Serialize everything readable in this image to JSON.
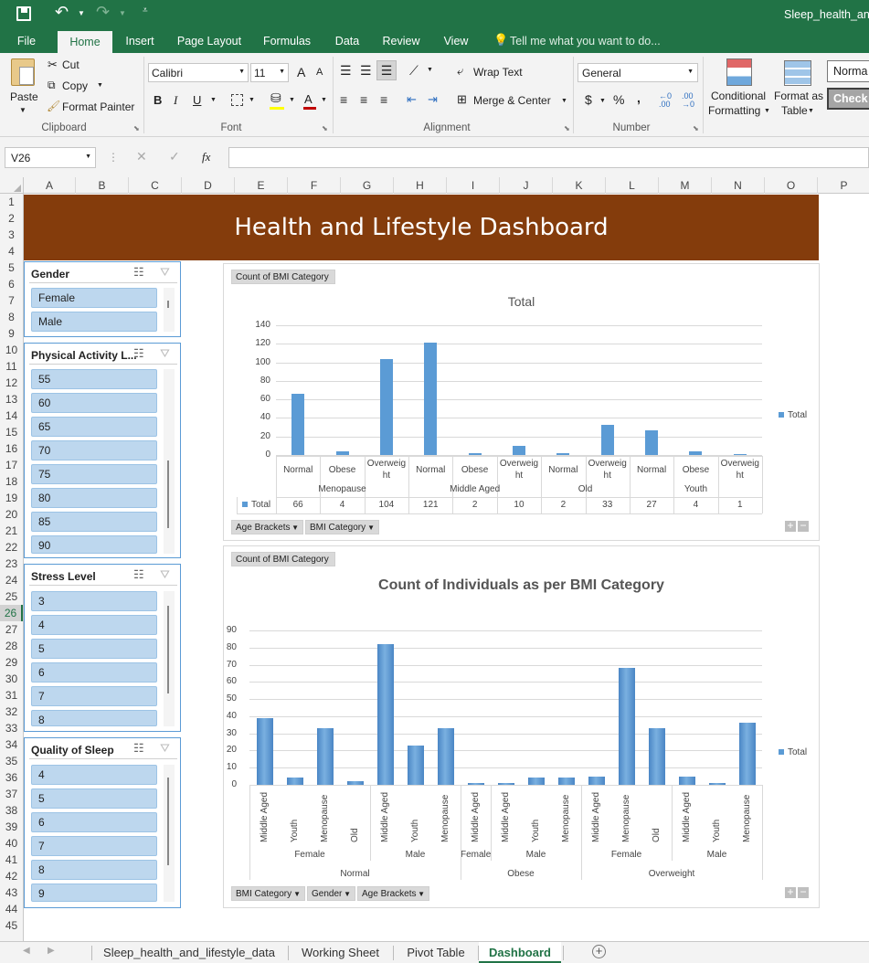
{
  "window": {
    "title": "Sleep_health_and_"
  },
  "ribbon_tabs": [
    "File",
    "Home",
    "Insert",
    "Page Layout",
    "Formulas",
    "Data",
    "Review",
    "View"
  ],
  "tell_me": "Tell me what you want to do...",
  "clipboard": {
    "paste": "Paste",
    "cut": "Cut",
    "copy": "Copy",
    "format_painter": "Format Painter",
    "group": "Clipboard"
  },
  "font": {
    "name": "Calibri",
    "size": "11",
    "group": "Font",
    "bold": "B",
    "italic": "I",
    "underline": "U",
    "grow": "A",
    "shrink": "A",
    "color": "A"
  },
  "alignment": {
    "wrap": "Wrap Text",
    "merge": "Merge & Center",
    "group": "Alignment"
  },
  "number": {
    "format": "General",
    "currency": "$",
    "percent": "%",
    "comma": ",",
    "group": "Number"
  },
  "styles": {
    "conditional": [
      "Conditional",
      "Formatting"
    ],
    "format_table": [
      "Format as",
      "Table"
    ],
    "normal": "Norma",
    "check": "Check"
  },
  "formula_bar": {
    "name_box": "V26",
    "fx": "fx",
    "value": ""
  },
  "columns": [
    "A",
    "B",
    "C",
    "D",
    "E",
    "F",
    "G",
    "H",
    "I",
    "J",
    "K",
    "L",
    "M",
    "N",
    "O",
    "P"
  ],
  "rows": [
    "1",
    "2",
    "3",
    "4",
    "5",
    "6",
    "7",
    "8",
    "9",
    "10",
    "11",
    "12",
    "13",
    "14",
    "15",
    "16",
    "17",
    "18",
    "19",
    "20",
    "21",
    "22",
    "23",
    "24",
    "25",
    "26",
    "27",
    "28",
    "29",
    "30",
    "31",
    "32",
    "33",
    "34",
    "35",
    "36",
    "37",
    "38",
    "39",
    "40",
    "41",
    "42",
    "43",
    "44",
    "45"
  ],
  "dashboard_title": "Health and Lifestyle Dashboard",
  "slicers": [
    {
      "title": "Gender",
      "items": [
        "Female",
        "Male"
      ]
    },
    {
      "title": "Physical Activity L...",
      "items": [
        "55",
        "60",
        "65",
        "70",
        "75",
        "80",
        "85",
        "90"
      ]
    },
    {
      "title": "Stress Level",
      "items": [
        "3",
        "4",
        "5",
        "6",
        "7",
        "8"
      ]
    },
    {
      "title": "Quality of Sleep",
      "items": [
        "4",
        "5",
        "6",
        "7",
        "8",
        "9"
      ]
    }
  ],
  "chart1": {
    "field_button": "Count of BMI Category",
    "title": "Total",
    "legend": "Total",
    "row_fields": [
      "Age Brackets",
      "BMI Category"
    ],
    "chart_data": {
      "type": "bar",
      "title": "Total",
      "ylim": [
        0,
        140
      ],
      "yticks": [
        "0",
        "20",
        "40",
        "60",
        "80",
        "100",
        "120",
        "140"
      ],
      "groups": [
        {
          "name": "Menopause",
          "categories": [
            "Normal",
            "Obese",
            "Overweight"
          ],
          "values": [
            66,
            4,
            104
          ]
        },
        {
          "name": "Middle Aged",
          "categories": [
            "Normal",
            "Obese",
            "Overweight"
          ],
          "values": [
            121,
            2,
            10
          ]
        },
        {
          "name": "Old",
          "categories": [
            "Normal",
            "Overweight"
          ],
          "values": [
            2,
            33
          ]
        },
        {
          "name": "Youth",
          "categories": [
            "Normal",
            "Obese",
            "Overweight"
          ],
          "values": [
            27,
            4,
            1
          ]
        }
      ],
      "series": [
        {
          "name": "Total",
          "values": [
            66,
            4,
            104,
            121,
            2,
            10,
            2,
            33,
            27,
            4,
            1
          ]
        }
      ],
      "data_table_label": "Total"
    }
  },
  "chart2": {
    "field_button": "Count of BMI Category",
    "title": "Count of Individuals as per BMI Category",
    "legend": "Total",
    "row_fields": [
      "BMI Category",
      "Gender",
      "Age Brackets"
    ],
    "chart_data": {
      "type": "bar",
      "title": "Count of Individuals as per BMI Category",
      "ylim": [
        0,
        90
      ],
      "yticks": [
        "0",
        "10",
        "20",
        "30",
        "40",
        "50",
        "60",
        "70",
        "80",
        "90"
      ],
      "categories": [
        "Middle Aged",
        "Youth",
        "Menopause",
        "Old",
        "Middle Aged",
        "Youth",
        "Menopause",
        "Middle Aged",
        "Middle Aged",
        "Youth",
        "Menopause",
        "Middle Aged",
        "Menopause",
        "Old",
        "Middle Aged",
        "Youth",
        "Menopause"
      ],
      "values": [
        39,
        4,
        33,
        2,
        82,
        23,
        33,
        1,
        1,
        4,
        4,
        5,
        68,
        33,
        5,
        1,
        36
      ],
      "gender_groups": [
        {
          "name": "Female",
          "count": 4
        },
        {
          "name": "Male",
          "count": 3
        },
        {
          "name": "Female",
          "count": 1
        },
        {
          "name": "Male",
          "count": 3
        },
        {
          "name": "Female",
          "count": 3
        },
        {
          "name": "Male",
          "count": 3
        }
      ],
      "bmi_groups": [
        {
          "name": "Normal",
          "count": 7
        },
        {
          "name": "Obese",
          "count": 4
        },
        {
          "name": "Overweight",
          "count": 6
        }
      ],
      "series": [
        {
          "name": "Total",
          "values": [
            39,
            4,
            33,
            2,
            82,
            23,
            33,
            1,
            1,
            4,
            4,
            5,
            68,
            33,
            5,
            1,
            36
          ]
        }
      ]
    }
  },
  "sheet_tabs": [
    "Sleep_health_and_lifestyle_data",
    "Working Sheet",
    "Pivot Table",
    "Dashboard"
  ],
  "active_sheet": "Dashboard",
  "colors": {
    "excel_green": "#217346",
    "banner": "#843c0c",
    "bar": "#5b9bd5",
    "slicer_item": "#bdd7ee"
  }
}
